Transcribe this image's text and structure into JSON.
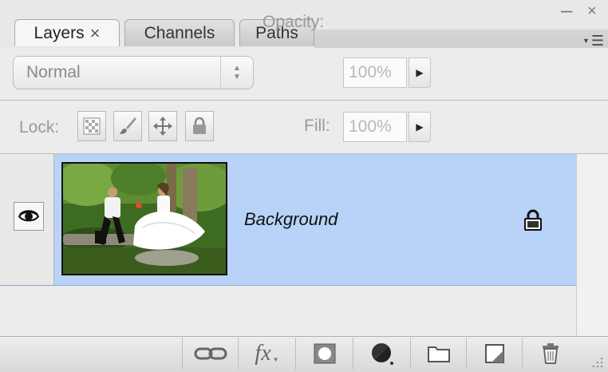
{
  "window": {
    "minimize": "–",
    "close": "×"
  },
  "tabs": [
    {
      "label": "Layers",
      "active": true,
      "close": "×"
    },
    {
      "label": "Channels",
      "active": false
    },
    {
      "label": "Paths",
      "active": false
    }
  ],
  "options": {
    "blend_mode": "Normal",
    "opacity_label": "Opacity:",
    "opacity_value": "100%",
    "lock_label": "Lock:",
    "fill_label": "Fill:",
    "fill_value": "100%"
  },
  "lock_buttons": [
    {
      "icon": "transparency-lock-icon"
    },
    {
      "icon": "brush-lock-icon"
    },
    {
      "icon": "move-lock-icon"
    },
    {
      "icon": "padlock-icon"
    }
  ],
  "layers": [
    {
      "name": "Background",
      "visible": true,
      "locked": true
    }
  ],
  "toolbar": [
    {
      "icon": "link-layers-icon"
    },
    {
      "icon": "fx-icon",
      "label": "fx"
    },
    {
      "icon": "layer-mask-icon"
    },
    {
      "icon": "adjustment-layer-icon"
    },
    {
      "icon": "new-group-icon"
    },
    {
      "icon": "new-layer-icon"
    },
    {
      "icon": "trash-icon"
    }
  ],
  "colors": {
    "selected_row": "#b8d2f8",
    "panel_bg": "#ececec"
  }
}
